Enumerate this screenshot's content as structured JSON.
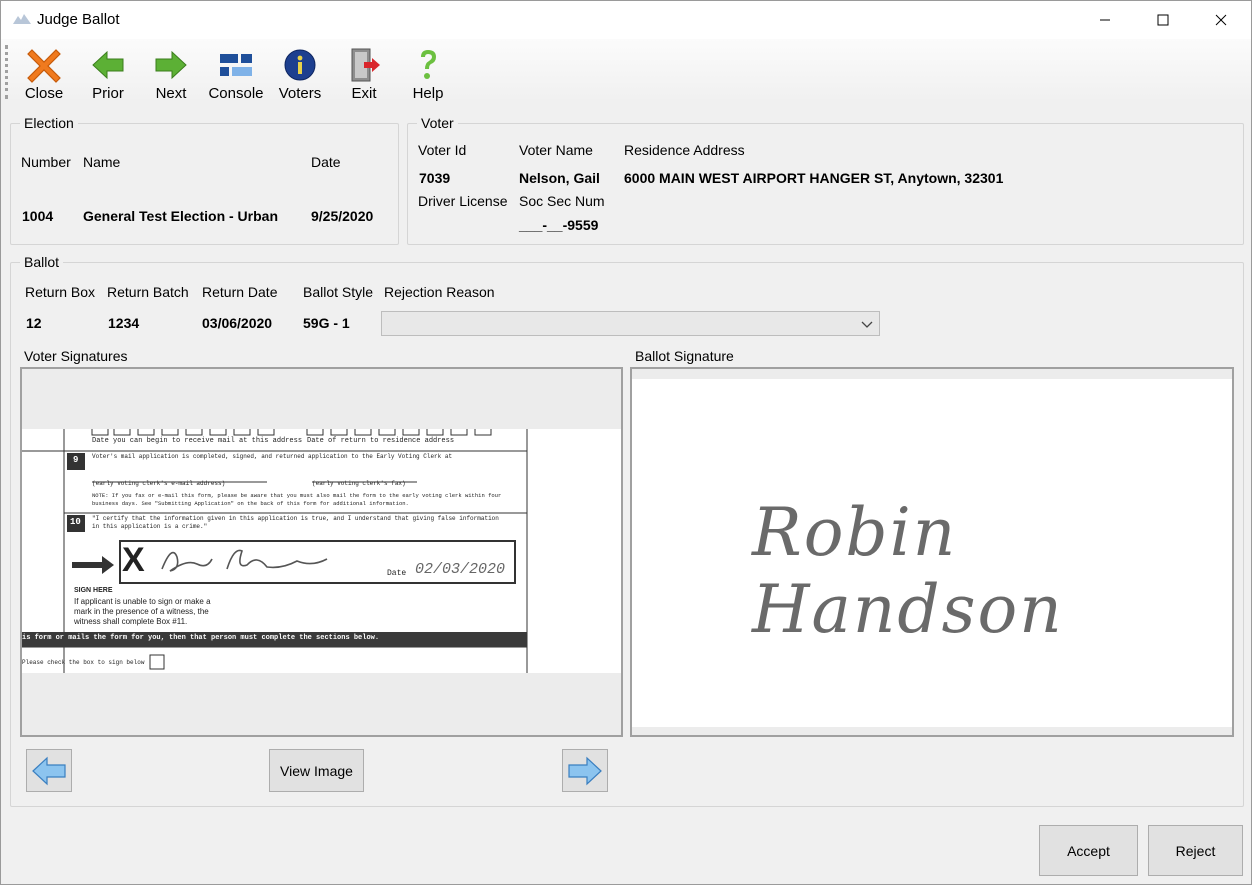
{
  "window": {
    "title": "Judge Ballot"
  },
  "toolbar": {
    "items": [
      {
        "label": "Close",
        "icon": "close-icon"
      },
      {
        "label": "Prior",
        "icon": "arrow-left-icon"
      },
      {
        "label": "Next",
        "icon": "arrow-right-icon"
      },
      {
        "label": "Console",
        "icon": "console-icon"
      },
      {
        "label": "Voters",
        "icon": "info-icon"
      },
      {
        "label": "Exit",
        "icon": "exit-icon"
      },
      {
        "label": "Help",
        "icon": "help-icon"
      }
    ]
  },
  "election": {
    "title": "Election",
    "number_label": "Number",
    "name_label": "Name",
    "date_label": "Date",
    "number": "1004",
    "name": "General Test Election - Urban",
    "date": "9/25/2020"
  },
  "voter": {
    "title": "Voter",
    "id_label": "Voter Id",
    "name_label": "Voter Name",
    "address_label": "Residence Address",
    "id": "7039",
    "name": "Nelson, Gail",
    "address": "6000 MAIN WEST AIRPORT HANGER ST, Anytown, 32301",
    "license_label": "Driver License",
    "ssn_label": "Soc Sec Num",
    "ssn": "___-__-9559"
  },
  "ballot": {
    "title": "Ballot",
    "return_box_label": "Return Box",
    "return_batch_label": "Return Batch",
    "return_date_label": "Return Date",
    "style_label": "Ballot Style",
    "rejection_label": "Rejection Reason",
    "return_box": "12",
    "return_batch": "1234",
    "return_date": "03/06/2020",
    "style": "59G - 1",
    "rejection_value": ""
  },
  "signatures": {
    "voter_label": "Voter Signatures",
    "ballot_label": "Ballot Signature",
    "ballot_signature_text": "Robin Handson",
    "doc_lines": {
      "line1": "Date you can begin to receive mail at this address",
      "line1b": "Date of return to residence address",
      "box9": "9",
      "line2": "Voter's mail application is completed, signed, and returned application to the Early Voting Clerk at",
      "line3": "(early voting clerk's e-mail address)",
      "line3b": "(early voting clerk's fax)",
      "line4": "NOTE: If you fax or e-mail this form, please be aware that you must also mail the form to the early voting clerk within four",
      "line5": "business days. See \"Submitting Application\" on the back of this form for additional information.",
      "box10": "10",
      "line6": "\"I certify that the information given in this application is true, and I understand that giving false information",
      "line7": "in this application is a crime.\"",
      "x_mark": "X",
      "date_label": "Date",
      "date_value": "02/03/2020",
      "sign_here": "SIGN HERE",
      "sign1": "If applicant is unable to sign or make a",
      "sign2": "mark in the presence of a witness, the",
      "sign3": "witness shall complete Box #11.",
      "banner": "is form or mails the form for you, then that person must complete the sections below.",
      "check": "Please check the box to sign below"
    }
  },
  "buttons": {
    "view_image": "View Image",
    "accept": "Accept",
    "reject": "Reject"
  }
}
